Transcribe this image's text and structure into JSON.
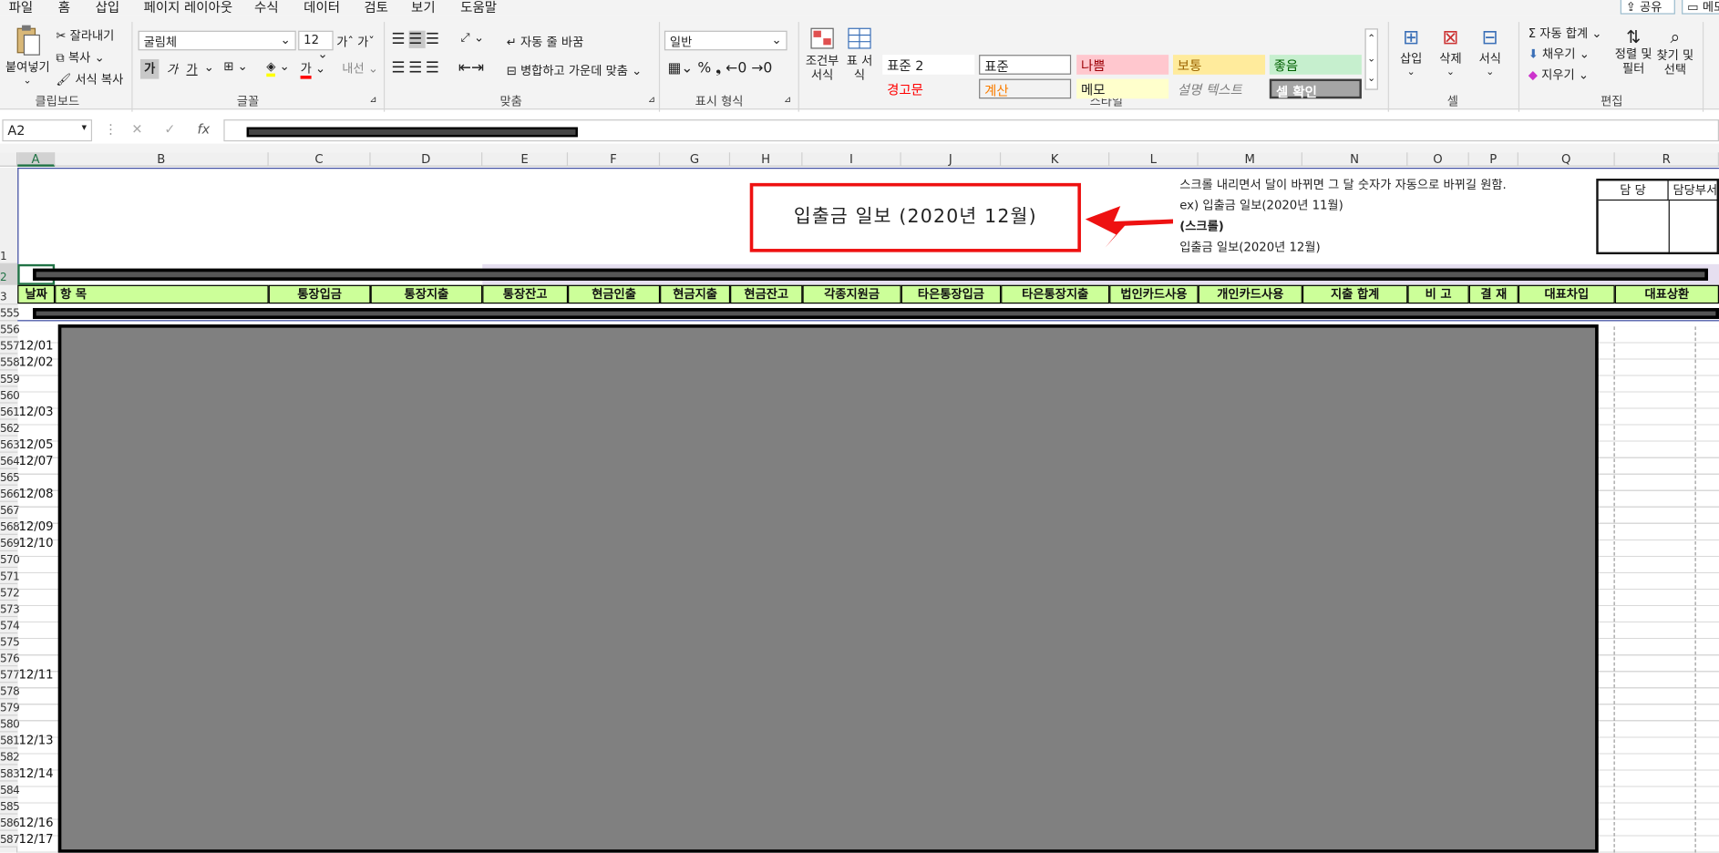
{
  "tabs": [
    "파일",
    "홈",
    "삽입",
    "페이지 레이아웃",
    "수식",
    "데이터",
    "검토",
    "보기",
    "도움말"
  ],
  "share": {
    "share_label": "공유",
    "memo_label": "메모"
  },
  "clipboard": {
    "paste": "붙여넣기",
    "cut": "잘라내기",
    "copy": "복사",
    "format_painter": "서식 복사",
    "group": "클립보드"
  },
  "font": {
    "name": "굴림체",
    "size": "12",
    "bold": "가",
    "italic": "가",
    "underline": "가",
    "group": "글꼴"
  },
  "alignment": {
    "wrap": "자동 줄 바꿈",
    "merge": "병합하고 가운데 맞춤",
    "group": "맞춤"
  },
  "number": {
    "format": "일반",
    "group": "표시 형식"
  },
  "styles": {
    "cond": "조건부 서식",
    "table": "표 서식",
    "items": [
      {
        "label": "표준 2",
        "color": "#222222",
        "bg": "#ffffff"
      },
      {
        "label": "표준",
        "color": "#222222",
        "bg": "#ffffff"
      },
      {
        "label": "나쁨",
        "color": "#9c0006",
        "bg": "#ffc7ce"
      },
      {
        "label": "보통",
        "color": "#9c6500",
        "bg": "#ffeb9c"
      },
      {
        "label": "좋음",
        "color": "#006100",
        "bg": "#c6efce"
      },
      {
        "label": "경고문",
        "color": "#ff0000",
        "bg": "#f3f3f3"
      },
      {
        "label": "계산",
        "color": "#fa7d00",
        "bg": "#f2f2f2"
      },
      {
        "label": "메모",
        "color": "#222222",
        "bg": "#ffffcc"
      },
      {
        "label": "설명 텍스트",
        "color": "#7f7f7f",
        "bg": "#f3f3f3"
      },
      {
        "label": "셀 확인",
        "color": "#ffffff",
        "bg": "#a5a5a5"
      }
    ],
    "group": "스타일"
  },
  "cells": {
    "insert": "삽입",
    "delete": "삭제",
    "format": "서식",
    "group": "셀"
  },
  "editing": {
    "autosum": "자동 합계",
    "fill": "채우기",
    "clear": "지우기",
    "sort": "정렬 및 필터",
    "find": "찾기 및 선택",
    "group": "편집"
  },
  "formula_bar": {
    "name_box": "A2",
    "fx": "fx"
  },
  "columns": [
    "A",
    "B",
    "C",
    "D",
    "E",
    "F",
    "G",
    "H",
    "I",
    "J",
    "K",
    "L",
    "M",
    "N",
    "O",
    "P",
    "Q",
    "R"
  ],
  "sheet": {
    "title": "입출금 일보 (2020년 12월)",
    "note_line1": "스크롤 내리면서 달이 바뀌면 그 달 숫자가 자동으로 바뀌길 원함.",
    "note_line2": "ex) 입출금 일보(2020년 11월)",
    "note_line3": "(스크롤)",
    "note_line4": "입출금 일보(2020년 12월)",
    "approve_1": "담 당",
    "approve_2": "담당부서",
    "headers": [
      "날짜",
      "항  목",
      "통장입금",
      "통장지출",
      "통장잔고",
      "현금인출",
      "현금지출",
      "현금잔고",
      "각종지원금",
      "타은통장입금",
      "타은통장지출",
      "법인카드사용",
      "개인카드사용",
      "지출 합계",
      "비 고",
      "결 재",
      "대표차입",
      "대표상환"
    ]
  },
  "rows": [
    {
      "num": "1",
      "date": ""
    },
    {
      "num": "2",
      "date": ""
    },
    {
      "num": "3",
      "date": ""
    },
    {
      "num": "555",
      "date": ""
    },
    {
      "num": "556",
      "date": ""
    },
    {
      "num": "557",
      "date": "12/01"
    },
    {
      "num": "558",
      "date": "12/02"
    },
    {
      "num": "559",
      "date": ""
    },
    {
      "num": "560",
      "date": ""
    },
    {
      "num": "561",
      "date": "12/03"
    },
    {
      "num": "562",
      "date": ""
    },
    {
      "num": "563",
      "date": "12/05"
    },
    {
      "num": "564",
      "date": "12/07"
    },
    {
      "num": "565",
      "date": ""
    },
    {
      "num": "566",
      "date": "12/08"
    },
    {
      "num": "567",
      "date": ""
    },
    {
      "num": "568",
      "date": "12/09"
    },
    {
      "num": "569",
      "date": "12/10"
    },
    {
      "num": "570",
      "date": ""
    },
    {
      "num": "571",
      "date": ""
    },
    {
      "num": "572",
      "date": ""
    },
    {
      "num": "573",
      "date": ""
    },
    {
      "num": "574",
      "date": ""
    },
    {
      "num": "575",
      "date": ""
    },
    {
      "num": "576",
      "date": ""
    },
    {
      "num": "577",
      "date": "12/11"
    },
    {
      "num": "578",
      "date": ""
    },
    {
      "num": "579",
      "date": ""
    },
    {
      "num": "580",
      "date": ""
    },
    {
      "num": "581",
      "date": "12/13"
    },
    {
      "num": "582",
      "date": ""
    },
    {
      "num": "583",
      "date": "12/14"
    },
    {
      "num": "584",
      "date": ""
    },
    {
      "num": "585",
      "date": ""
    },
    {
      "num": "586",
      "date": "12/16"
    },
    {
      "num": "587",
      "date": "12/17"
    }
  ]
}
